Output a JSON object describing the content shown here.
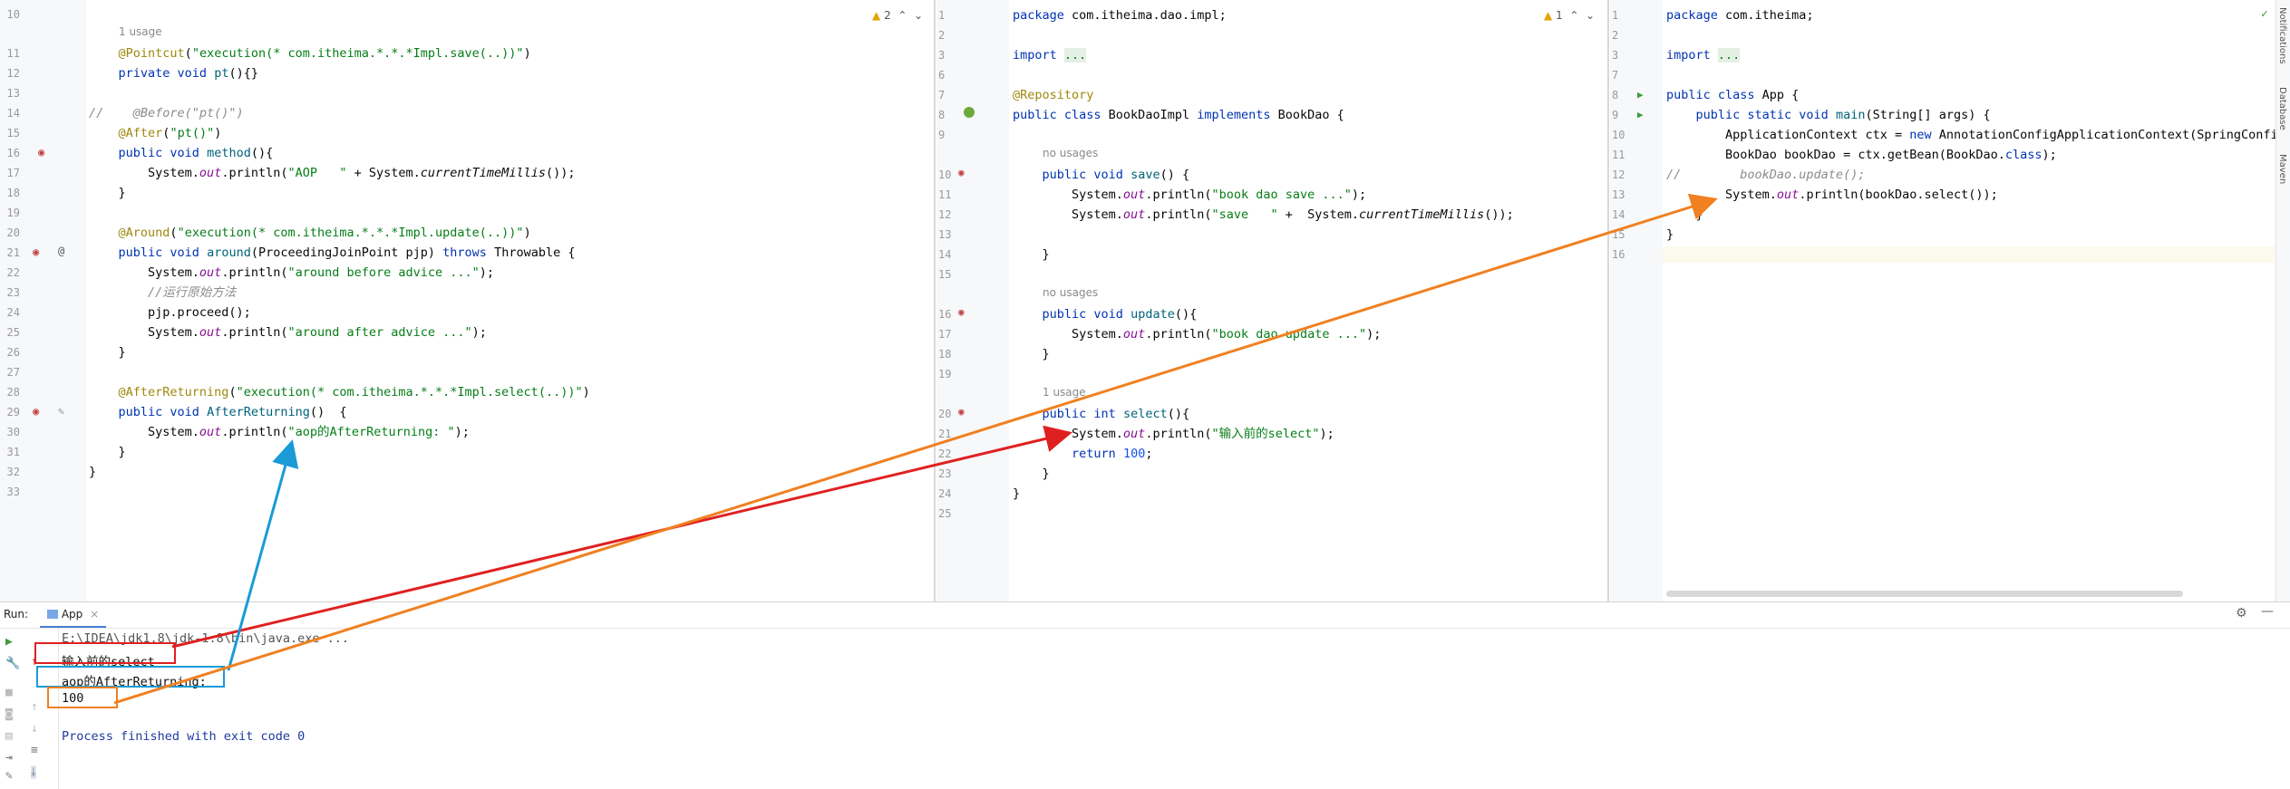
{
  "left_editor": {
    "warning_count": "2",
    "lines": [
      {
        "n": "10",
        "c": ""
      },
      {
        "n": "11",
        "c": "    <span class='an'>@Pointcut</span>(<span class='str'>\"execution(* com.itheima.*.*.*Impl.save(..))\"</span>)"
      },
      {
        "n": "12",
        "c": "    <span class='kw'>private void</span> <span class='meth'>pt</span>(){}"
      },
      {
        "n": "13",
        "c": ""
      },
      {
        "n": "14",
        "c": "<span class='cm'>//    @Before(\"pt()\")</span>"
      },
      {
        "n": "15",
        "c": "    <span class='an'>@After</span>(<span class='str'>\"pt()\"</span>)"
      },
      {
        "n": "16",
        "c": "    <span class='kw'>public void</span> <span class='meth'>method</span>(){"
      },
      {
        "n": "17",
        "c": "        System.<span class='fld'>out</span>.println(<span class='str'>\"AOP   \"</span> + System.<span class='it'>currentTimeMillis</span>());"
      },
      {
        "n": "18",
        "c": "    }"
      },
      {
        "n": "19",
        "c": ""
      },
      {
        "n": "20",
        "c": "    <span class='an'>@Around</span>(<span class='str'>\"execution(* com.itheima.*.*.*Impl.update(..))\"</span>)"
      },
      {
        "n": "21",
        "c": "    <span class='kw'>public void</span> <span class='meth'>around</span>(ProceedingJoinPoint pjp) <span class='kw'>throws</span> Throwable {"
      },
      {
        "n": "22",
        "c": "        System.<span class='fld'>out</span>.println(<span class='str'>\"around before advice ...\"</span>);"
      },
      {
        "n": "23",
        "c": "        <span class='cm'>//运行原始方法</span>"
      },
      {
        "n": "24",
        "c": "        pjp.proceed();"
      },
      {
        "n": "25",
        "c": "        System.<span class='fld'>out</span>.println(<span class='str'>\"around after advice ...\"</span>);"
      },
      {
        "n": "26",
        "c": "    }"
      },
      {
        "n": "27",
        "c": ""
      },
      {
        "n": "28",
        "c": "    <span class='an'>@AfterReturning</span>(<span class='str'>\"execution(* com.itheima.*.*.*Impl.select(..))\"</span>)"
      },
      {
        "n": "29",
        "c": "    <span class='kw'>public void</span> <span class='meth'>AfterReturning</span>()  {"
      },
      {
        "n": "30",
        "c": "        System.<span class='fld'>out</span>.println(<span class='str'>\"aop的AfterReturning: \"</span>);"
      },
      {
        "n": "31",
        "c": "    }"
      },
      {
        "n": "32",
        "c": "}"
      },
      {
        "n": "33",
        "c": ""
      }
    ],
    "hint_usage": "1 usage"
  },
  "middle_editor": {
    "warning_count": "1",
    "lines": [
      {
        "n": "1",
        "c": "<span class='kw'>package</span> com.itheima.dao.impl;"
      },
      {
        "n": "2",
        "c": ""
      },
      {
        "n": "3",
        "c": "<span class='kw'>import</span> <span class='fold'>...</span>"
      },
      {
        "n": "6",
        "c": ""
      },
      {
        "n": "7",
        "c": "<span class='an'>@Repository</span>"
      },
      {
        "n": "8",
        "c": "<span class='kw'>public class</span> BookDaoImpl <span class='kw'>implements</span> BookDao {"
      },
      {
        "n": "9",
        "c": ""
      },
      {
        "n": "10",
        "c": "    <span class='kw'>public void</span> <span class='meth'>save</span>() {"
      },
      {
        "n": "11",
        "c": "        System.<span class='fld'>out</span>.println(<span class='str'>\"book dao save ...\"</span>);"
      },
      {
        "n": "12",
        "c": "        System.<span class='fld'>out</span>.println(<span class='str'>\"save   \"</span> +  System.<span class='it'>currentTimeMillis</span>());"
      },
      {
        "n": "13",
        "c": ""
      },
      {
        "n": "14",
        "c": "    }"
      },
      {
        "n": "15",
        "c": ""
      },
      {
        "n": "16",
        "c": "    <span class='kw'>public void</span> <span class='meth'>update</span>(){"
      },
      {
        "n": "17",
        "c": "        System.<span class='fld'>out</span>.println(<span class='str'>\"book dao update ...\"</span>);"
      },
      {
        "n": "18",
        "c": "    }"
      },
      {
        "n": "19",
        "c": ""
      },
      {
        "n": "20",
        "c": "    <span class='kw'>public int</span> <span class='meth'>select</span>(){"
      },
      {
        "n": "21",
        "c": "        System.<span class='fld'>out</span>.println(<span class='str'>\"输入前的select\"</span>);"
      },
      {
        "n": "22",
        "c": "        <span class='kw'>return</span> <span class='num'>100</span>;"
      },
      {
        "n": "23",
        "c": "    }"
      },
      {
        "n": "24",
        "c": "}"
      },
      {
        "n": "25",
        "c": ""
      }
    ],
    "hint_no_usages": "no usages",
    "hint_usage": "1 usage"
  },
  "right_editor": {
    "lines": [
      {
        "n": "1",
        "c": "<span class='kw'>package</span> com.itheima;"
      },
      {
        "n": "2",
        "c": ""
      },
      {
        "n": "3",
        "c": "<span class='kw'>import</span> <span class='fold'>...</span>"
      },
      {
        "n": "7",
        "c": ""
      },
      {
        "n": "8",
        "c": "<span class='kw'>public class</span> App {"
      },
      {
        "n": "9",
        "c": "    <span class='kw'>public static void</span> <span class='meth'>main</span>(String[] args) {"
      },
      {
        "n": "10",
        "c": "        ApplicationContext ctx = <span class='kw'>new</span> AnnotationConfigApplicationContext(SpringConfig"
      },
      {
        "n": "11",
        "c": "        BookDao bookDao = ctx.getBean(BookDao.<span class='kw'>class</span>);"
      },
      {
        "n": "12",
        "c": "<span class='cm'>//        bookDao.update();</span>"
      },
      {
        "n": "13",
        "c": "        System.<span class='fld'>out</span>.println(bookDao.select());"
      },
      {
        "n": "14",
        "c": "    }"
      },
      {
        "n": "15",
        "c": "}"
      },
      {
        "n": "16",
        "c": ""
      }
    ]
  },
  "run_panel": {
    "label": "Run:",
    "tab": "App",
    "output": [
      "E:\\IDEA\\jdk1.8\\jdk-1.8\\bin\\java.exe ...",
      "输入前的select",
      "aop的AfterReturning: ",
      "100",
      "",
      "Process finished with exit code 0"
    ]
  },
  "right_toolbar": [
    "Notifications",
    "Database",
    "Maven"
  ]
}
